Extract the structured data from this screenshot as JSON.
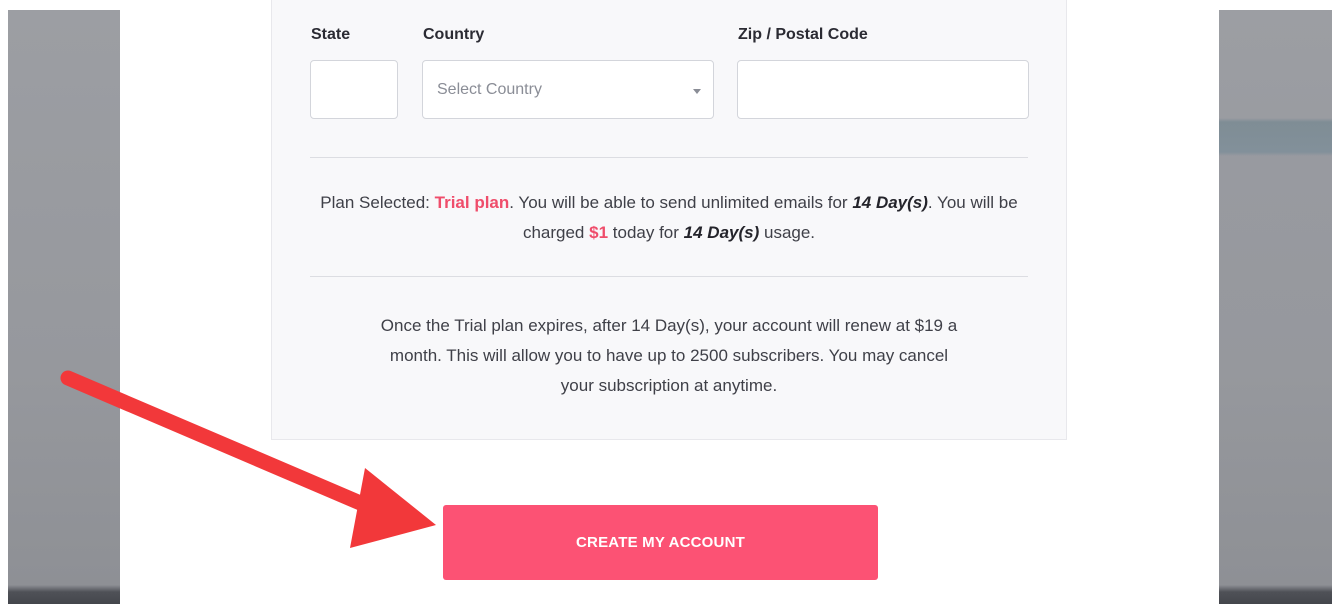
{
  "form": {
    "state_label": "State",
    "state_value": "",
    "country_label": "Country",
    "country_selected": "Select Country",
    "zip_label": "Zip / Postal Code",
    "zip_value": ""
  },
  "plan_summary": {
    "prefix": "Plan Selected: ",
    "plan_name": "Trial plan",
    "part_2": ". You will be able to send unlimited emails for ",
    "duration_1": "14 Day(s)",
    "part_3": ". You will be charged ",
    "price": "$1",
    "part_4": " today for ",
    "duration_2": "14 Day(s)",
    "part_5": " usage."
  },
  "renewal_notice": {
    "line_1": "Once the Trial plan expires, after 14 Day(s), your account will renew at $19 a",
    "line_2": "month. This will allow you to have up to 2500 subscribers. You may cancel",
    "line_3": "your subscription at anytime."
  },
  "cta": {
    "label": "CREATE MY ACCOUNT"
  },
  "colors": {
    "accent": "#ef4d6b",
    "button": "#fc5274",
    "annotation_arrow": "#f2383a"
  },
  "icons": {
    "country_select_caret": "chevron-down-icon",
    "annotation": "red-arrow-annotation"
  }
}
